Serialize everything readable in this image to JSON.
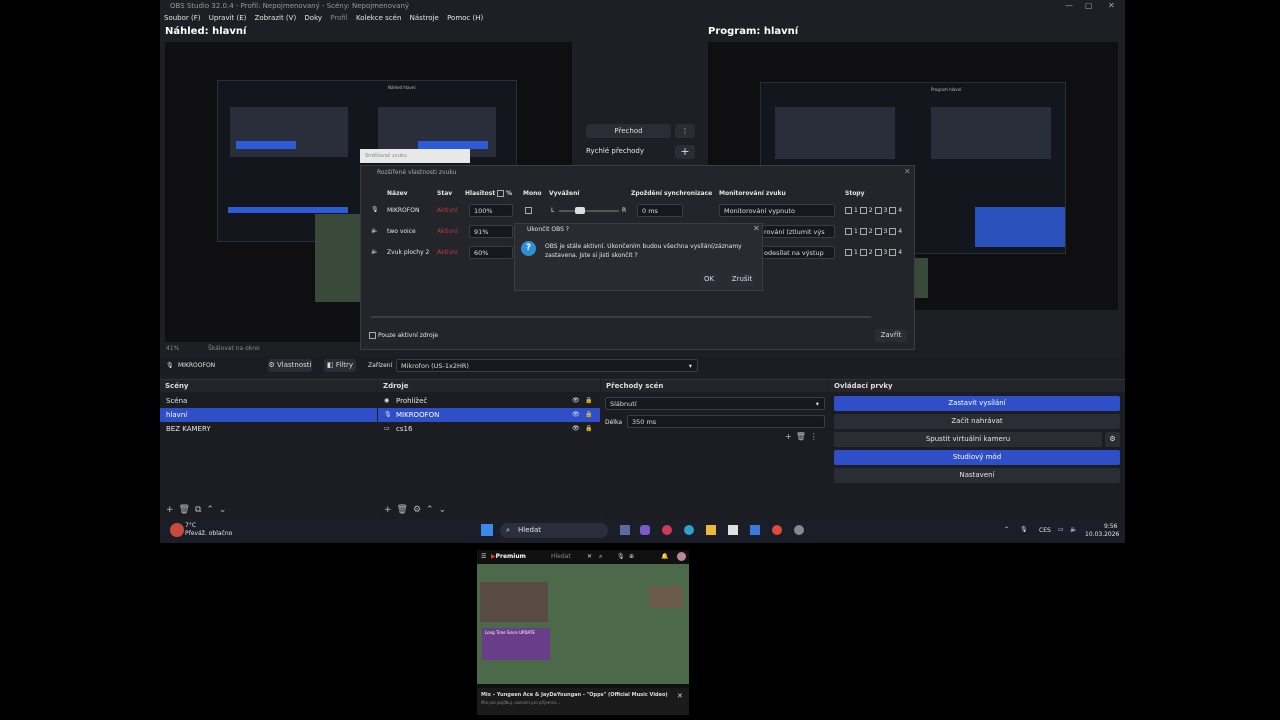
{
  "window": {
    "title": "OBS Studio 32.0.4 - Profil: Nepojmenovaný - Scény: Nepojmenovaný",
    "controls": [
      "—",
      "▢",
      "✕"
    ]
  },
  "menu": [
    "Soubor (F)",
    "Upravit (E)",
    "Zobrazit (V)",
    "Doky",
    "Profil",
    "Kolekce scén",
    "Nástroje",
    "Pomoc (H)"
  ],
  "preview": {
    "title": "Náhled: hlavní",
    "inner_title": "Náhled hlavní"
  },
  "program": {
    "title": "Program: hlavní",
    "inner_title": "Program hlavní"
  },
  "transition": {
    "button": "Přechod",
    "quick": "Rychlé přechody",
    "more_icon": "kebab-icon",
    "add_icon": "plus-icon"
  },
  "scale_bar": {
    "zoom": "41%",
    "label": "Škálovat na okno"
  },
  "audio_dialog": {
    "title": "Rozšířené vlastnosti zvuku",
    "columns": [
      "Název",
      "Stav",
      "Hlasitost",
      "%",
      "Mono",
      "Vyvážení",
      "Zpoždění synchronizace",
      "Monitorování zvuku",
      "Stopy"
    ],
    "rows": [
      {
        "name": "MIKROFON",
        "status": "Aktivní",
        "volume": "100%",
        "sync": "0 ms",
        "monitor": "Monitorování vypnuto"
      },
      {
        "name": "two voice",
        "status": "Aktivní",
        "volume": "91%",
        "sync": "",
        "monitor": "rování (ztlumit výs"
      },
      {
        "name": "Zvuk plochy 2",
        "status": "Aktivní",
        "volume": "60%",
        "sync": "",
        "monitor": "odesílat na výstup"
      }
    ],
    "tracks": [
      "1",
      "2",
      "3",
      "4"
    ],
    "balance_l": "L",
    "balance_r": "R",
    "active_only": "Pouze aktivní zdroje",
    "close": "Zavřít",
    "hidden_tab": "Směšovač zvuku"
  },
  "confirm": {
    "title": "Ukončit OBS ?",
    "message_1": "OBS je stále aktivní. Ukončením budou všechna vysílání/záznamy",
    "message_2": "zastavena. Jste si jisti skončit ?",
    "ok": "OK",
    "cancel": "Zrušit"
  },
  "source_bar": {
    "source": "MIKROOFON",
    "properties": "Vlastnosti",
    "filters": "Filtry",
    "device_label": "Zařízení",
    "device": "Mikrofon (US-1x2HR)"
  },
  "scenes": {
    "title": "Scény",
    "items": [
      "Scéna",
      "hlavní",
      "BEZ KAMERY"
    ],
    "selected": 1
  },
  "sources": {
    "title": "Zdroje",
    "items": [
      "Prohlížeč",
      "MIKROOFON",
      "cs16"
    ],
    "selected": 1
  },
  "transitions": {
    "title": "Přechody scén",
    "type": "Slábnutí",
    "duration_label": "Délka",
    "duration": "350 ms"
  },
  "controls": {
    "title": "Ovládací prvky",
    "buttons": [
      "Zastavit vysílání",
      "Začít nahrávat",
      "Spustit virtuální kameru",
      "Studiový mód",
      "Nastavení"
    ]
  },
  "weather": {
    "temp": "7°C",
    "desc": "Převáž. oblačno"
  },
  "taskbar": {
    "search": "Hledat",
    "lang": "CES",
    "time": "9:56",
    "date": "10.03.2026"
  },
  "phone": {
    "premium": "Premium",
    "search": "Hledat",
    "video_title": "Mix – Yungeen Ace & JayDaYoungan - \"Opps\" (Official Music Video)",
    "video_sub": "Mix pro pojďbuj, seznam pro příjemce…",
    "thumb_label": "Long Time Since UPDATE"
  },
  "colors": {
    "accent": "#2f4fc9",
    "bg": "#1e1f24"
  }
}
